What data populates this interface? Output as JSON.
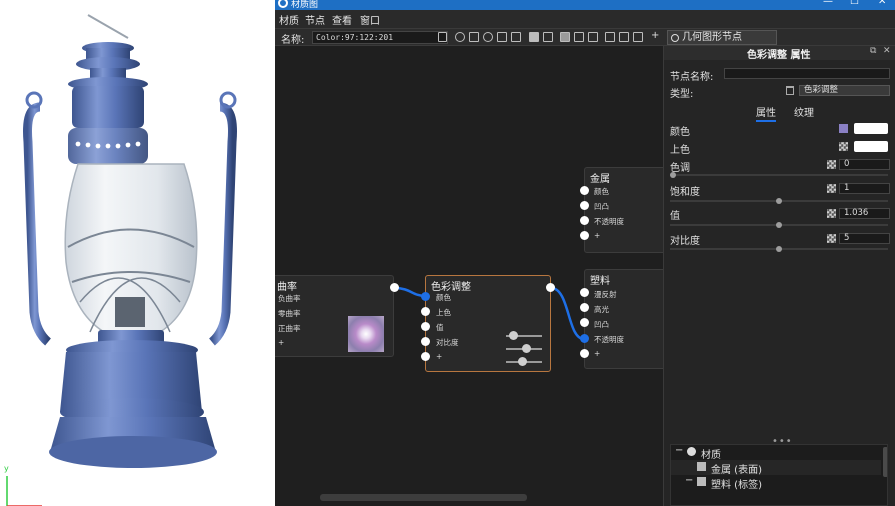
{
  "window": {
    "title": "材质图"
  },
  "menu": [
    "材质",
    "节点",
    "查看",
    "窗口"
  ],
  "toolbar": {
    "name_label": "名称:",
    "name_value": "Color:97:122:201",
    "geometry_button": "几何图形节点"
  },
  "graph": {
    "nodes": {
      "curvature": {
        "title": "曲率",
        "ports": [
          "负曲率",
          "零曲率",
          "正曲率",
          "+"
        ]
      },
      "color_adjust": {
        "title": "色彩调整",
        "ports": [
          "颜色",
          "上色",
          "值",
          "对比度",
          "+"
        ]
      },
      "metal": {
        "title": "金属",
        "ports": [
          "颜色",
          "凹凸",
          "不透明度",
          "+"
        ]
      },
      "plastic": {
        "title": "塑料",
        "ports": [
          "漫反射",
          "高光",
          "凹凸",
          "不透明度",
          "+"
        ]
      }
    }
  },
  "panel": {
    "title": "色彩调整 属性",
    "node_name_label": "节点名称:",
    "node_name_value": "",
    "type_label": "类型:",
    "type_value": "色彩调整",
    "tabs": [
      "属性",
      "纹理"
    ],
    "props": {
      "color_label": "颜色",
      "tint_label": "上色",
      "hue_label": "色调",
      "hue_value": "0",
      "hue_level": 0.0,
      "saturation_label": "饱和度",
      "saturation_value": "1",
      "saturation_level": 0.5,
      "value_label": "值",
      "value_value": "1.036",
      "value_level": 0.5,
      "contrast_label": "对比度",
      "contrast_value": "5",
      "contrast_level": 0.5
    },
    "more": "•••",
    "tree": [
      {
        "toggle": "−",
        "label": "材质"
      },
      {
        "toggle": "",
        "label": "金属 (表面)"
      },
      {
        "toggle": "−",
        "label": "塑料 (标签)"
      }
    ]
  },
  "colors": {
    "accent": "#1e6fe6",
    "node_selected": "#b7763f",
    "lantern": "#5a75b8"
  }
}
